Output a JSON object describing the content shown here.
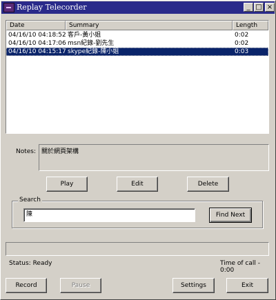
{
  "window": {
    "title": "Replay Telecorder",
    "controls": [
      "_",
      "□",
      "×"
    ]
  },
  "list": {
    "columns": [
      "Date",
      "Summary",
      "Length"
    ],
    "rows": [
      {
        "date": "04/16/10 04:18:52",
        "summary": "客戶-黃小姐",
        "length": "0:02",
        "selected": false
      },
      {
        "date": "04/16/10 04:17:06",
        "summary": "msn紀錄-劉先生",
        "length": "0:02",
        "selected": false
      },
      {
        "date": "04/16/10 04:15:17",
        "summary": "skype紀錄-陳小姐",
        "length": "0:03",
        "selected": true
      }
    ]
  },
  "notes": {
    "label": "Notes:",
    "value": "關於網頁架構"
  },
  "actions": {
    "play": "Play",
    "edit": "Edit",
    "delete": "Delete"
  },
  "search": {
    "label": "Search",
    "value": "陳",
    "find_next": "Find Next"
  },
  "status": {
    "text": "Status: Ready",
    "time_of_call": "Time of call - 0:00"
  },
  "bottom": {
    "record": "Record",
    "pause": "Pause",
    "settings": "Settings",
    "exit": "Exit"
  },
  "colors": {
    "title_bar": "#2a2a8a",
    "selection": "#0a246a",
    "face": "#d4d0c8"
  }
}
